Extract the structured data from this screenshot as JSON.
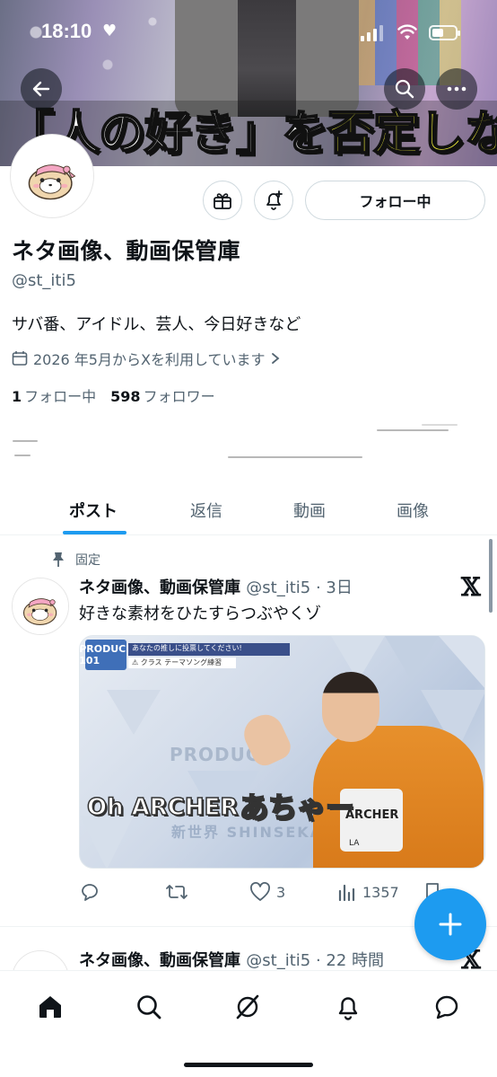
{
  "status_bar": {
    "time": "18:10",
    "heart": "♥"
  },
  "banner": {
    "caption_white_1": "「人の好き」を",
    "caption_yellow": "否定しない"
  },
  "header": {
    "back_icon": "arrow-left-icon",
    "search_icon": "search-icon",
    "more_icon": "more-icon"
  },
  "profile": {
    "display_name": "ネタ画像、動画保管庫",
    "handle": "@st_iti5",
    "bio": "サバ番、アイドル、芸人、今日好きなど",
    "joined": "2026 年5月からXを利用しています",
    "following_count": "1",
    "following_label": "フォロー中",
    "followers_count": "598",
    "followers_label": "フォロワー",
    "follow_button": "フォロー中"
  },
  "tabs": [
    {
      "label": "ポスト",
      "active": true
    },
    {
      "label": "返信",
      "active": false
    },
    {
      "label": "動画",
      "active": false
    },
    {
      "label": "画像",
      "active": false
    }
  ],
  "posts": [
    {
      "pinned_label": "固定",
      "name": "ネタ画像、動画保管庫",
      "meta": "@st_iti5 · 3日",
      "text": "好きな素材をひたすらつぶやくゾ",
      "media": {
        "logo": "PRODUCE 101",
        "notice_1": "あなたの推しに投票してください!",
        "notice_2": "⚠ クラス テーマソング練習",
        "produce_text": "PRODUCE",
        "shinsekai_text": "新世界 SHINSEKAI",
        "subtitle_en": "Oh ARCHER",
        "subtitle_jp": "あちゃー",
        "shirt_text": "ARCHER",
        "shirt_sub": "LA"
      },
      "likes": "3",
      "views": "1357"
    },
    {
      "name": "ネタ画像、動画保管庫",
      "meta": "@st_iti5 · 22 時間"
    }
  ],
  "colors": {
    "accent": "#1d9bf0",
    "text": "#0f1419",
    "muted": "#536471",
    "border": "#cfd9de"
  }
}
